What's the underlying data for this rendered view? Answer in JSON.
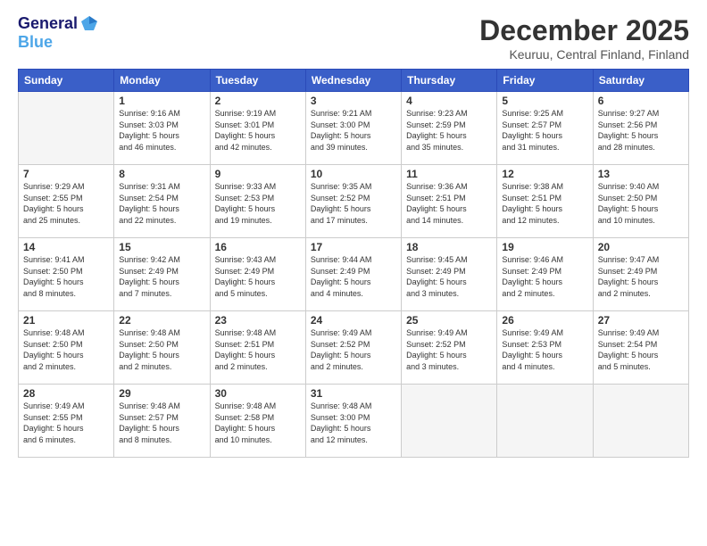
{
  "logo": {
    "line1": "General",
    "line2": "Blue"
  },
  "header": {
    "month": "December 2025",
    "location": "Keuruu, Central Finland, Finland"
  },
  "days_of_week": [
    "Sunday",
    "Monday",
    "Tuesday",
    "Wednesday",
    "Thursday",
    "Friday",
    "Saturday"
  ],
  "weeks": [
    [
      {
        "day": "",
        "info": ""
      },
      {
        "day": "1",
        "info": "Sunrise: 9:16 AM\nSunset: 3:03 PM\nDaylight: 5 hours\nand 46 minutes."
      },
      {
        "day": "2",
        "info": "Sunrise: 9:19 AM\nSunset: 3:01 PM\nDaylight: 5 hours\nand 42 minutes."
      },
      {
        "day": "3",
        "info": "Sunrise: 9:21 AM\nSunset: 3:00 PM\nDaylight: 5 hours\nand 39 minutes."
      },
      {
        "day": "4",
        "info": "Sunrise: 9:23 AM\nSunset: 2:59 PM\nDaylight: 5 hours\nand 35 minutes."
      },
      {
        "day": "5",
        "info": "Sunrise: 9:25 AM\nSunset: 2:57 PM\nDaylight: 5 hours\nand 31 minutes."
      },
      {
        "day": "6",
        "info": "Sunrise: 9:27 AM\nSunset: 2:56 PM\nDaylight: 5 hours\nand 28 minutes."
      }
    ],
    [
      {
        "day": "7",
        "info": "Sunrise: 9:29 AM\nSunset: 2:55 PM\nDaylight: 5 hours\nand 25 minutes."
      },
      {
        "day": "8",
        "info": "Sunrise: 9:31 AM\nSunset: 2:54 PM\nDaylight: 5 hours\nand 22 minutes."
      },
      {
        "day": "9",
        "info": "Sunrise: 9:33 AM\nSunset: 2:53 PM\nDaylight: 5 hours\nand 19 minutes."
      },
      {
        "day": "10",
        "info": "Sunrise: 9:35 AM\nSunset: 2:52 PM\nDaylight: 5 hours\nand 17 minutes."
      },
      {
        "day": "11",
        "info": "Sunrise: 9:36 AM\nSunset: 2:51 PM\nDaylight: 5 hours\nand 14 minutes."
      },
      {
        "day": "12",
        "info": "Sunrise: 9:38 AM\nSunset: 2:51 PM\nDaylight: 5 hours\nand 12 minutes."
      },
      {
        "day": "13",
        "info": "Sunrise: 9:40 AM\nSunset: 2:50 PM\nDaylight: 5 hours\nand 10 minutes."
      }
    ],
    [
      {
        "day": "14",
        "info": "Sunrise: 9:41 AM\nSunset: 2:50 PM\nDaylight: 5 hours\nand 8 minutes."
      },
      {
        "day": "15",
        "info": "Sunrise: 9:42 AM\nSunset: 2:49 PM\nDaylight: 5 hours\nand 7 minutes."
      },
      {
        "day": "16",
        "info": "Sunrise: 9:43 AM\nSunset: 2:49 PM\nDaylight: 5 hours\nand 5 minutes."
      },
      {
        "day": "17",
        "info": "Sunrise: 9:44 AM\nSunset: 2:49 PM\nDaylight: 5 hours\nand 4 minutes."
      },
      {
        "day": "18",
        "info": "Sunrise: 9:45 AM\nSunset: 2:49 PM\nDaylight: 5 hours\nand 3 minutes."
      },
      {
        "day": "19",
        "info": "Sunrise: 9:46 AM\nSunset: 2:49 PM\nDaylight: 5 hours\nand 2 minutes."
      },
      {
        "day": "20",
        "info": "Sunrise: 9:47 AM\nSunset: 2:49 PM\nDaylight: 5 hours\nand 2 minutes."
      }
    ],
    [
      {
        "day": "21",
        "info": "Sunrise: 9:48 AM\nSunset: 2:50 PM\nDaylight: 5 hours\nand 2 minutes."
      },
      {
        "day": "22",
        "info": "Sunrise: 9:48 AM\nSunset: 2:50 PM\nDaylight: 5 hours\nand 2 minutes."
      },
      {
        "day": "23",
        "info": "Sunrise: 9:48 AM\nSunset: 2:51 PM\nDaylight: 5 hours\nand 2 minutes."
      },
      {
        "day": "24",
        "info": "Sunrise: 9:49 AM\nSunset: 2:52 PM\nDaylight: 5 hours\nand 2 minutes."
      },
      {
        "day": "25",
        "info": "Sunrise: 9:49 AM\nSunset: 2:52 PM\nDaylight: 5 hours\nand 3 minutes."
      },
      {
        "day": "26",
        "info": "Sunrise: 9:49 AM\nSunset: 2:53 PM\nDaylight: 5 hours\nand 4 minutes."
      },
      {
        "day": "27",
        "info": "Sunrise: 9:49 AM\nSunset: 2:54 PM\nDaylight: 5 hours\nand 5 minutes."
      }
    ],
    [
      {
        "day": "28",
        "info": "Sunrise: 9:49 AM\nSunset: 2:55 PM\nDaylight: 5 hours\nand 6 minutes."
      },
      {
        "day": "29",
        "info": "Sunrise: 9:48 AM\nSunset: 2:57 PM\nDaylight: 5 hours\nand 8 minutes."
      },
      {
        "day": "30",
        "info": "Sunrise: 9:48 AM\nSunset: 2:58 PM\nDaylight: 5 hours\nand 10 minutes."
      },
      {
        "day": "31",
        "info": "Sunrise: 9:48 AM\nSunset: 3:00 PM\nDaylight: 5 hours\nand 12 minutes."
      },
      {
        "day": "",
        "info": ""
      },
      {
        "day": "",
        "info": ""
      },
      {
        "day": "",
        "info": ""
      }
    ]
  ]
}
